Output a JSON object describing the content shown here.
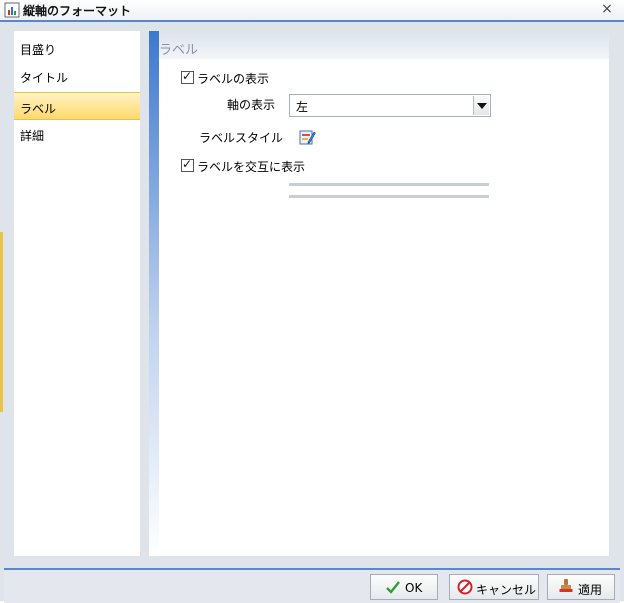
{
  "window": {
    "title": "縦軸のフォーマット",
    "close_glyph": "×"
  },
  "sidebar": {
    "items": [
      {
        "label": "目盛り",
        "selected": false
      },
      {
        "label": "タイトル",
        "selected": false
      },
      {
        "label": "ラベル",
        "selected": true
      },
      {
        "label": "詳細",
        "selected": false
      }
    ]
  },
  "content": {
    "section_title": "ラベル",
    "show_labels": {
      "label": "ラベルの表示",
      "checked": true
    },
    "axis_display": {
      "label": "軸の表示",
      "value": "左"
    },
    "label_style": {
      "label": "ラベルスタイル",
      "icon": "edit-style-icon"
    },
    "alternate_labels": {
      "label": "ラベルを交互に表示",
      "checked": true
    }
  },
  "footer": {
    "ok_label": "OK",
    "cancel_label": "キャンセル",
    "apply_label": "適用"
  },
  "colors": {
    "accent_blue": "#5b86c8",
    "selected_bg": "#ffd86c",
    "section_text": "#8a93a4"
  }
}
